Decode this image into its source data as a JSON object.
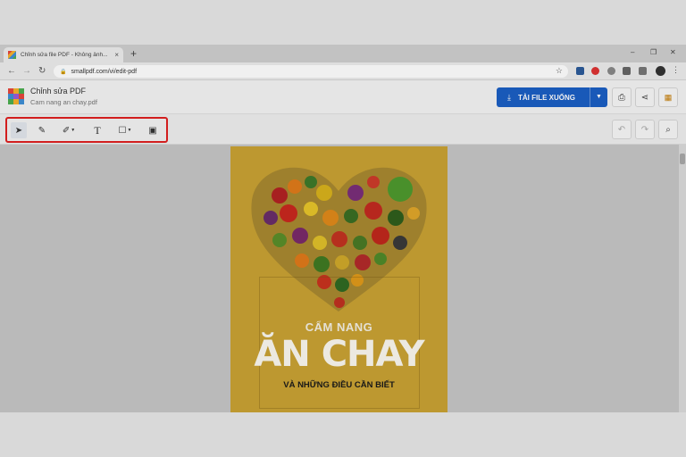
{
  "browser": {
    "tab_title": "Chỉnh sửa file PDF - Không ảnh...",
    "tab_close": "×",
    "new_tab": "+",
    "url": "smallpdf.com/vi/edit-pdf",
    "window_controls": [
      "–",
      "❐",
      "✕"
    ],
    "icons": [
      "back-icon",
      "forward-icon",
      "reload-icon",
      "lock-icon",
      "star-icon",
      "extensions-icon",
      "menu-icon"
    ]
  },
  "app": {
    "title": "Chỉnh sửa PDF",
    "file_name": "Cam nang an chay.pdf",
    "download_label": "TẢI FILE XUỐNG",
    "accent_color": "#1b5fc4",
    "highlight_color": "#e02020"
  },
  "toolbar": {
    "tools": [
      "select-tool",
      "pen-tool",
      "highlighter-tool",
      "text-tool",
      "shape-tool",
      "image-tool"
    ],
    "right_tools": [
      "undo",
      "redo",
      "search"
    ]
  },
  "document": {
    "cover_subtitle": "CẨM NANG",
    "cover_title": "ĂN CHAY",
    "cover_tagline": "VÀ NHỮNG ĐIỀU CẦN BIẾT",
    "cover_color": "#c9a233"
  }
}
